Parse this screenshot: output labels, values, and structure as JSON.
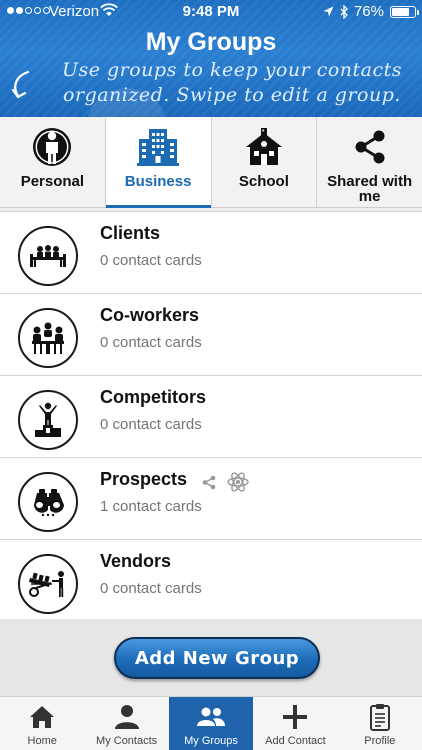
{
  "status_bar": {
    "carrier": "Verizon",
    "time": "9:48 PM",
    "battery": "76%",
    "battery_level": 0.76,
    "signal_bars_filled": 2,
    "signal_bars_total": 5
  },
  "header": {
    "title": "My Groups",
    "subtitle_line1": "Use groups to keep your contacts",
    "subtitle_line2": "organized. Swipe to edit a group."
  },
  "tabs": [
    {
      "label": "Personal",
      "icon": "person-icon",
      "active": false
    },
    {
      "label": "Business",
      "icon": "office-building-icon",
      "active": true
    },
    {
      "label": "School",
      "icon": "schoolhouse-icon",
      "active": false
    },
    {
      "label": "Shared with me",
      "icon": "share-icon",
      "active": false
    }
  ],
  "groups": [
    {
      "name": "Clients",
      "count": "0 contact cards",
      "icon": "meeting-table-icon"
    },
    {
      "name": "Co-workers",
      "count": "0 contact cards",
      "icon": "team-icon"
    },
    {
      "name": "Competitors",
      "count": "0 contact cards",
      "icon": "podium-icon"
    },
    {
      "name": "Prospects",
      "count": "1 contact cards",
      "icon": "binoculars-icon",
      "shared": true,
      "synced": true
    },
    {
      "name": "Vendors",
      "count": "0 contact cards",
      "icon": "hand-truck-icon"
    }
  ],
  "add_group_button": "Add New Group",
  "bottom_nav": [
    {
      "label": "Home",
      "icon": "home-icon",
      "active": false
    },
    {
      "label": "My Contacts",
      "icon": "contact-icon",
      "active": false
    },
    {
      "label": "My Groups",
      "icon": "groups-icon",
      "active": true
    },
    {
      "label": "Add Contact",
      "icon": "plus-icon",
      "active": false
    },
    {
      "label": "Profile",
      "icon": "clipboard-icon",
      "active": false
    }
  ],
  "colors": {
    "header_blue": "#1e6fc2",
    "active_tab": "#1d6bb3",
    "nav_active": "#1f63ad",
    "button_blue": "#1d6bb8"
  }
}
